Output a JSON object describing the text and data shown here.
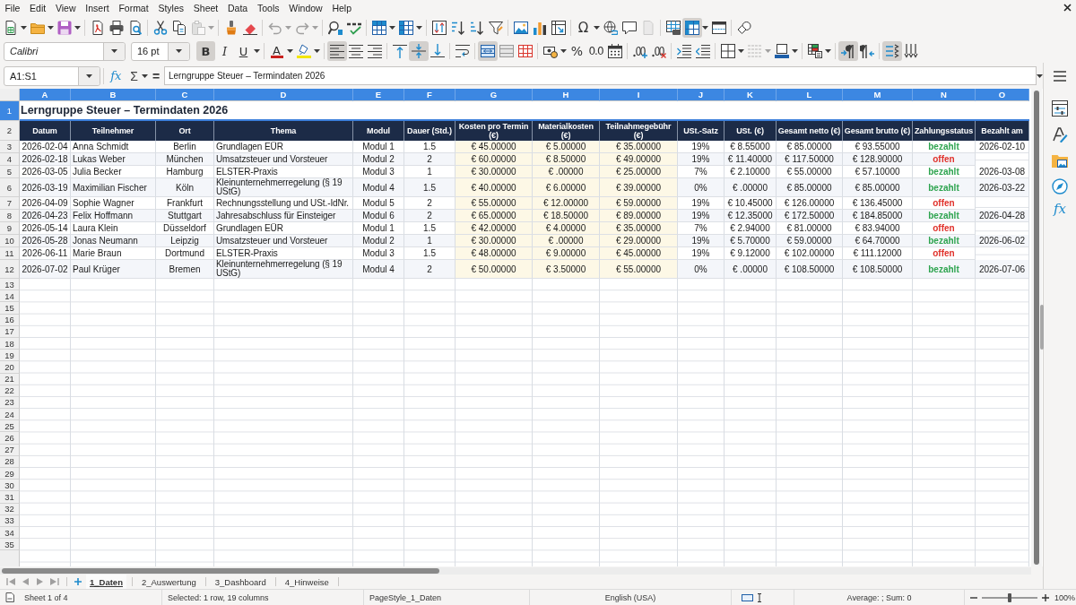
{
  "menu_bar": {
    "items": [
      "File",
      "Edit",
      "View",
      "Insert",
      "Format",
      "Styles",
      "Sheet",
      "Data",
      "Tools",
      "Window",
      "Help"
    ]
  },
  "standard_toolbar": {
    "paste": {
      "disabled": true
    },
    "undo": {
      "disabled": true
    },
    "redo": {
      "disabled": true
    },
    "special_character": "Ω",
    "header_footer": {
      "disabled": true
    },
    "freeze_rows_columns": {
      "on": true
    }
  },
  "formatting_toolbar": {
    "font_name": "Calibri",
    "font_size": "16 pt",
    "bold": {
      "glyph": "B",
      "on": true
    },
    "italic": {
      "glyph": "I",
      "on": false
    },
    "underline": {
      "glyph": "U",
      "on": false
    },
    "font_color": "A",
    "align_left": {
      "on": true
    },
    "align_center": {
      "on": false
    },
    "align_right": {
      "on": false
    },
    "align_top": {
      "on": false
    },
    "align_middle": {
      "on": true
    },
    "align_bottom": {
      "on": false
    },
    "merge_and_center": {
      "on": true
    },
    "percent": "%",
    "number": "0.0",
    "border_style": {
      "disabled": true
    },
    "left_to_right": {
      "on": true
    },
    "right_to_left": {
      "on": false
    },
    "text_left_to_right": {
      "on": true
    },
    "text_top_to_bottom": {
      "on": false
    }
  },
  "formula_bar": {
    "name_box": "A1:S1",
    "function_wizard": "fx",
    "sum": "Σ",
    "equals": "=",
    "content": "Lerngruppe Steuer – Termindaten 2026"
  },
  "sidebar": {
    "functions": "fx"
  },
  "sheet": {
    "columns": [
      {
        "label": "A",
        "selected": true
      },
      {
        "label": "B",
        "selected": true
      },
      {
        "label": "C",
        "selected": true
      },
      {
        "label": "D",
        "selected": true
      },
      {
        "label": "E",
        "selected": true
      },
      {
        "label": "F",
        "selected": true
      },
      {
        "label": "G",
        "selected": true
      },
      {
        "label": "H",
        "selected": true
      },
      {
        "label": "I",
        "selected": true
      },
      {
        "label": "J",
        "selected": true
      },
      {
        "label": "K",
        "selected": true
      },
      {
        "label": "L",
        "selected": true
      },
      {
        "label": "M",
        "selected": true
      },
      {
        "label": "N",
        "selected": true
      },
      {
        "label": "O",
        "selected": true
      }
    ],
    "title_row": {
      "row": "1",
      "selected": true,
      "title": "Lerngruppe Steuer – Termindaten 2026"
    },
    "header_row": {
      "row": "2",
      "selected": false,
      "labels": [
        "Datum",
        "Teilnehmer",
        "Ort",
        "Thema",
        "Modul",
        "Dauer (Std.)",
        "Kosten pro Termin (€)",
        "Materialkosten (€)",
        "Teilnahmegebühr (€)",
        "USt.-Satz",
        "USt. (€)",
        "Gesamt netto (€)",
        "Gesamt brutto (€)",
        "Zahlungsstatus",
        "Bezahlt am"
      ]
    },
    "data_rows": [
      {
        "row": "3",
        "selected": false,
        "date": "2026-02-04",
        "participant": "Anna Schmidt",
        "city": "Berlin",
        "topic": "Grundlagen EÜR",
        "module": "Modul 1",
        "hours": "1.5",
        "cost_per_session": "€ 45.00000",
        "material_cost": "€ 5.00000",
        "fee": "€ 35.00000",
        "vat_rate": "19%",
        "vat": "€ 8.55000",
        "net_total": "€ 85.00000",
        "gross_total": "€ 93.55000",
        "status": {
          "label": "bezahlt",
          "color": "#2ea44f"
        },
        "paid_on": "2026-02-10"
      },
      {
        "row": "4",
        "selected": false,
        "date": "2026-02-18",
        "participant": "Lukas Weber",
        "city": "München",
        "topic": "Umsatzsteuer und Vorsteuer",
        "module": "Modul 2",
        "hours": "2",
        "cost_per_session": "€ 60.00000",
        "material_cost": "€ 8.50000",
        "fee": "€ 49.00000",
        "vat_rate": "19%",
        "vat": "€ 11.40000",
        "net_total": "€ 117.50000",
        "gross_total": "€ 128.90000",
        "status": {
          "label": "offen",
          "color": "#e0302a"
        }
      },
      {
        "row": "5",
        "selected": false,
        "date": "2026-03-05",
        "participant": "Julia Becker",
        "city": "Hamburg",
        "topic": "ELSTER-Praxis",
        "module": "Modul 3",
        "hours": "1",
        "cost_per_session": "€ 30.00000",
        "material_cost": "€ .00000",
        "fee": "€ 25.00000",
        "vat_rate": "7%",
        "vat": "€ 2.10000",
        "net_total": "€ 55.00000",
        "gross_total": "€ 57.10000",
        "status": {
          "label": "bezahlt",
          "color": "#2ea44f"
        },
        "paid_on": "2026-03-08"
      },
      {
        "row": "6",
        "selected": false,
        "date": "2026-03-19",
        "participant": "Maximilian Fischer",
        "city": "Köln",
        "topic": "Kleinunternehmerregelung (§ 19 UStG)",
        "module": "Modul 4",
        "hours": "1.5",
        "cost_per_session": "€ 40.00000",
        "material_cost": "€ 6.00000",
        "fee": "€ 39.00000",
        "vat_rate": "0%",
        "vat": "€ .00000",
        "net_total": "€ 85.00000",
        "gross_total": "€ 85.00000",
        "status": {
          "label": "bezahlt",
          "color": "#2ea44f"
        },
        "paid_on": "2026-03-22"
      },
      {
        "row": "7",
        "selected": false,
        "date": "2026-04-09",
        "participant": "Sophie Wagner",
        "city": "Frankfurt",
        "topic": "Rechnungsstellung und USt.-IdNr.",
        "module": "Modul 5",
        "hours": "2",
        "cost_per_session": "€ 55.00000",
        "material_cost": "€ 12.00000",
        "fee": "€ 59.00000",
        "vat_rate": "19%",
        "vat": "€ 10.45000",
        "net_total": "€ 126.00000",
        "gross_total": "€ 136.45000",
        "status": {
          "label": "offen",
          "color": "#e0302a"
        }
      },
      {
        "row": "8",
        "selected": false,
        "date": "2026-04-23",
        "participant": "Felix Hoffmann",
        "city": "Stuttgart",
        "topic": "Jahresabschluss für Einsteiger",
        "module": "Modul 6",
        "hours": "2",
        "cost_per_session": "€ 65.00000",
        "material_cost": "€ 18.50000",
        "fee": "€ 89.00000",
        "vat_rate": "19%",
        "vat": "€ 12.35000",
        "net_total": "€ 172.50000",
        "gross_total": "€ 184.85000",
        "status": {
          "label": "bezahlt",
          "color": "#2ea44f"
        },
        "paid_on": "2026-04-28"
      },
      {
        "row": "9",
        "selected": false,
        "date": "2026-05-14",
        "participant": "Laura Klein",
        "city": "Düsseldorf",
        "topic": "Grundlagen EÜR",
        "module": "Modul 1",
        "hours": "1.5",
        "cost_per_session": "€ 42.00000",
        "material_cost": "€ 4.00000",
        "fee": "€ 35.00000",
        "vat_rate": "7%",
        "vat": "€ 2.94000",
        "net_total": "€ 81.00000",
        "gross_total": "€ 83.94000",
        "status": {
          "label": "offen",
          "color": "#e0302a"
        }
      },
      {
        "row": "10",
        "selected": false,
        "date": "2026-05-28",
        "participant": "Jonas Neumann",
        "city": "Leipzig",
        "topic": "Umsatzsteuer und Vorsteuer",
        "module": "Modul 2",
        "hours": "1",
        "cost_per_session": "€ 30.00000",
        "material_cost": "€ .00000",
        "fee": "€ 29.00000",
        "vat_rate": "19%",
        "vat": "€ 5.70000",
        "net_total": "€ 59.00000",
        "gross_total": "€ 64.70000",
        "status": {
          "label": "bezahlt",
          "color": "#2ea44f"
        },
        "paid_on": "2026-06-02"
      },
      {
        "row": "11",
        "selected": false,
        "date": "2026-06-11",
        "participant": "Marie Braun",
        "city": "Dortmund",
        "topic": "ELSTER-Praxis",
        "module": "Modul 3",
        "hours": "1.5",
        "cost_per_session": "€ 48.00000",
        "material_cost": "€ 9.00000",
        "fee": "€ 45.00000",
        "vat_rate": "19%",
        "vat": "€ 9.12000",
        "net_total": "€ 102.00000",
        "gross_total": "€ 111.12000",
        "status": {
          "label": "offen",
          "color": "#e0302a"
        }
      },
      {
        "row": "12",
        "selected": false,
        "date": "2026-07-02",
        "participant": "Paul Krüger",
        "city": "Bremen",
        "topic": "Kleinunternehmerregelung (§ 19 UStG)",
        "module": "Modul 4",
        "hours": "2",
        "cost_per_session": "€ 50.00000",
        "material_cost": "€ 3.50000",
        "fee": "€ 55.00000",
        "vat_rate": "0%",
        "vat": "€ .00000",
        "net_total": "€ 108.50000",
        "gross_total": "€ 108.50000",
        "status": {
          "label": "bezahlt",
          "color": "#2ea44f"
        },
        "paid_on": "2026-07-06"
      }
    ],
    "empty_rows": [
      {
        "row": "13",
        "selected": false
      },
      {
        "row": "14",
        "selected": false
      },
      {
        "row": "15",
        "selected": false
      },
      {
        "row": "16",
        "selected": false
      },
      {
        "row": "17",
        "selected": false
      },
      {
        "row": "18",
        "selected": false
      },
      {
        "row": "19",
        "selected": false
      },
      {
        "row": "20",
        "selected": false
      },
      {
        "row": "21",
        "selected": false
      },
      {
        "row": "22",
        "selected": false
      },
      {
        "row": "23",
        "selected": false
      },
      {
        "row": "24",
        "selected": false
      },
      {
        "row": "25",
        "selected": false
      },
      {
        "row": "26",
        "selected": false
      },
      {
        "row": "27",
        "selected": false
      },
      {
        "row": "28",
        "selected": false
      },
      {
        "row": "29",
        "selected": false
      },
      {
        "row": "30",
        "selected": false
      },
      {
        "row": "31",
        "selected": false
      },
      {
        "row": "32",
        "selected": false
      },
      {
        "row": "33",
        "selected": false
      },
      {
        "row": "34",
        "selected": false
      },
      {
        "row": "35",
        "selected": false
      }
    ]
  },
  "sheet_tabs": {
    "navigation_disabled": true,
    "tabs": [
      {
        "label": "1_Daten",
        "selected": true
      },
      {
        "label": "2_Auswertung",
        "selected": false
      },
      {
        "label": "3_Dashboard",
        "selected": false
      },
      {
        "label": "4_Hinweise",
        "selected": false
      }
    ]
  },
  "status_bar": {
    "sheet": "Sheet 1 of 4",
    "selection": "Selected: 1 row, 19 columns",
    "page_style": "PageStyle_1_Daten",
    "language": "English (USA)",
    "statistics": "Average: ; Sum: 0",
    "zoom": {
      "level": 0.5,
      "reading": "100%"
    }
  }
}
